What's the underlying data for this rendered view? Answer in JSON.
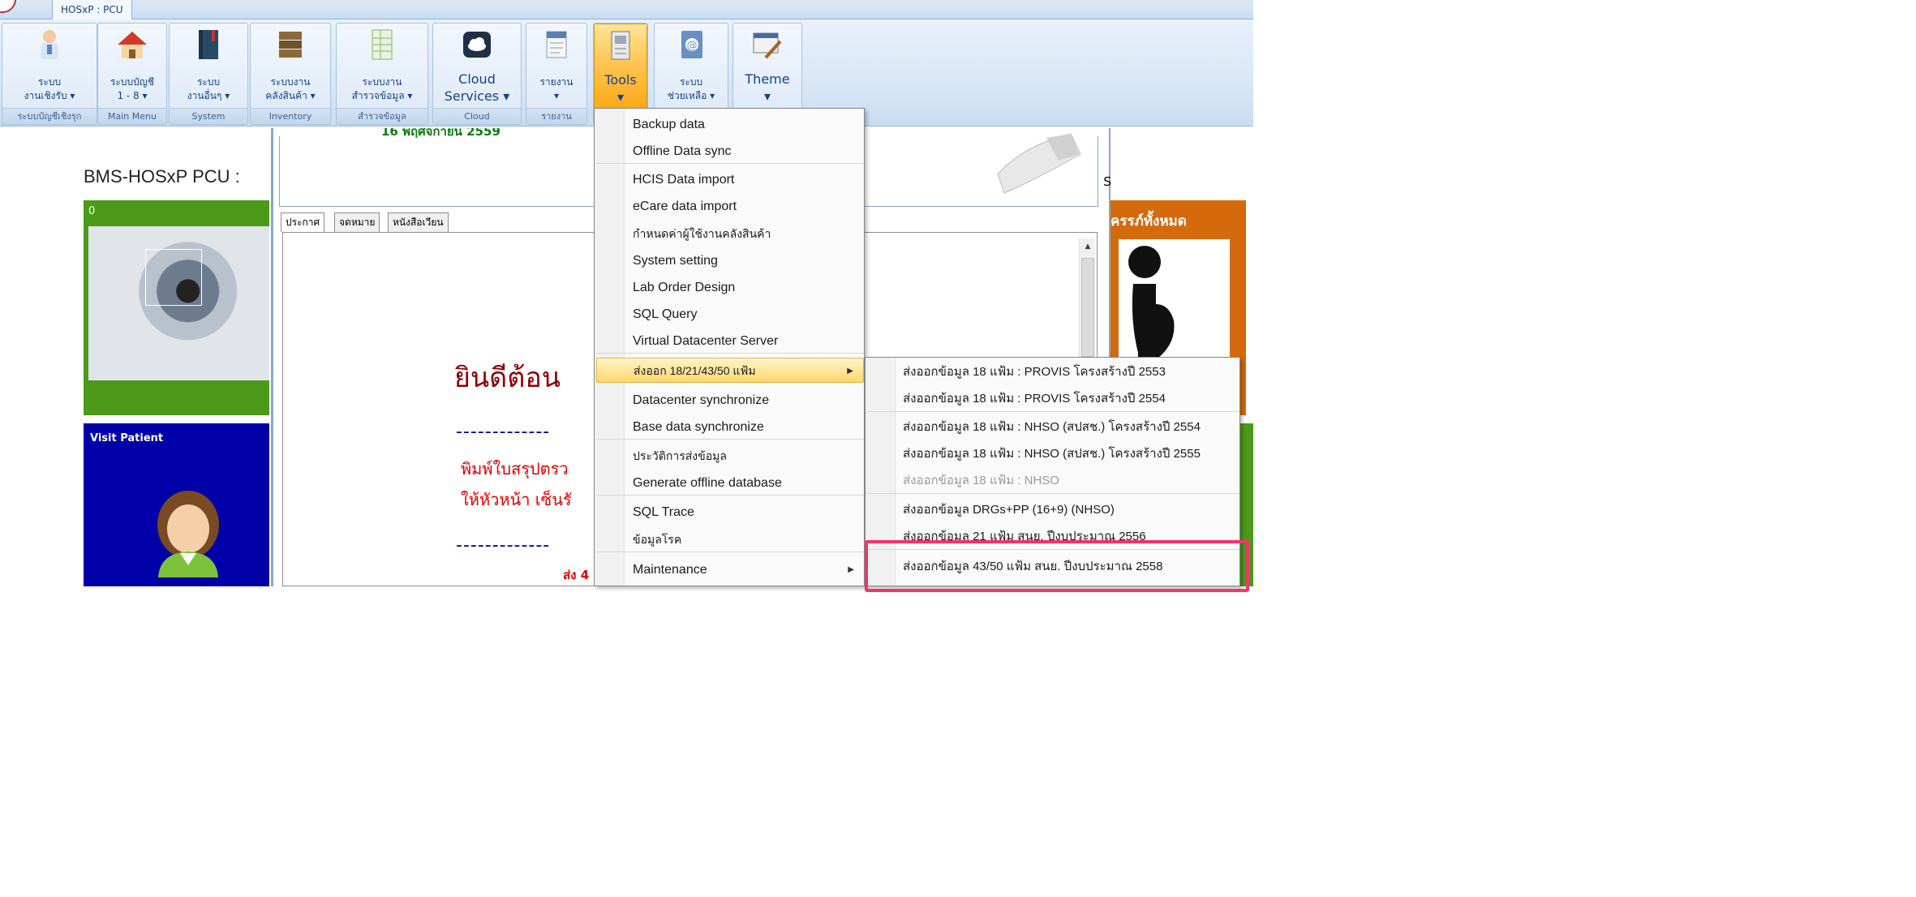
{
  "window": {
    "tab_label": "HOSxP : PCU"
  },
  "ribbon": {
    "groups": [
      {
        "label": "ระบบ\nงานเชิงรับ ▾",
        "footer": "ระบบบัญชีเชิงรุก",
        "icon": "doctor-icon"
      },
      {
        "label": "ระบบบัญชี\n1 - 8 ▾",
        "footer": "Main Menu",
        "icon": "house-icon"
      },
      {
        "label": "ระบบ\nงานอื่นๆ ▾",
        "footer": "System",
        "icon": "book-icon"
      },
      {
        "label": "ระบบงาน\nคลังสินค้า ▾",
        "footer": "Inventory",
        "icon": "boxes-icon"
      },
      {
        "label": "ระบบงาน\nสำรวจข้อมูล ▾",
        "footer": "สำรวจข้อมูล",
        "icon": "spreadsheet-icon"
      },
      {
        "label": "Cloud\nServices ▾",
        "footer": "Cloud",
        "icon": "cloud-icon"
      },
      {
        "label": "รายงาน\n▾",
        "footer": "รายงาน",
        "icon": "report-icon"
      },
      {
        "label": "Tools\n▾",
        "footer": "",
        "icon": "tools-icon"
      },
      {
        "label": "ระบบ\nช่วยเหลือ ▾",
        "footer": "",
        "icon": "help-icon"
      },
      {
        "label": "Theme\n▾",
        "footer": "",
        "icon": "theme-icon"
      }
    ]
  },
  "left": {
    "title": "BMS-HOSxP PCU :",
    "green_tile_count": "0",
    "visit_title": "Visit Patient"
  },
  "center": {
    "date": "16 พฤศจิกายน 2559",
    "right_letter": "s",
    "tabs": [
      "ประกาศ",
      "จดหมาย",
      "หนังสือเวียน"
    ],
    "welcome": "ยินดีต้อน",
    "dashes": "-------------",
    "line_print": "พิมพ์ใบสรุปตรว",
    "line_sign": "ให้หัวหน้า เซ็นรั",
    "line_send": "ส่ง 4"
  },
  "right": {
    "orange_title": "ครรภ์ทั้งหมด"
  },
  "tools_menu": {
    "items": [
      "Backup data",
      "Offline Data sync",
      "HCIS Data import",
      "eCare data import",
      "กำหนดค่าผู้ใช้งานคลังสินค้า",
      "System setting",
      "Lab Order Design",
      "SQL Query",
      "Virtual Datacenter Server",
      "ส่งออก 18/21/43/50 แฟ้ม",
      "Datacenter synchronize",
      "Base data synchronize",
      "ประวัติการส่งข้อมูล",
      "Generate offline database",
      "SQL Trace",
      "ข้อมูลโรค",
      "Maintenance"
    ]
  },
  "export_submenu": {
    "items": [
      "ส่งออกข้อมูล 18 แฟ้ม : PROVIS โครงสร้างปี 2553",
      "ส่งออกข้อมูล 18 แฟ้ม : PROVIS โครงสร้างปี 2554",
      "ส่งออกข้อมูล 18 แฟ้ม : NHSO (สปสช.) โครงสร้างปี 2554",
      "ส่งออกข้อมูล 18 แฟ้ม : NHSO (สปสช.) โครงสร้างปี 2555",
      "ส่งออกข้อมูล 18 แฟ้ม : NHSO",
      "ส่งออกข้อมูล DRGs+PP (16+9) (NHSO)",
      "ส่งออกข้อมูล 21 แฟ้ม สนย. ปีงบประมาณ 2556",
      "ส่งออกข้อมูล 43/50 แฟ้ม สนย. ปีงบประมาณ 2558"
    ]
  },
  "colors": {
    "highlight": "#f0356c",
    "menu_hover": "#ffd86b",
    "ribbon": "#d6e5f6"
  }
}
